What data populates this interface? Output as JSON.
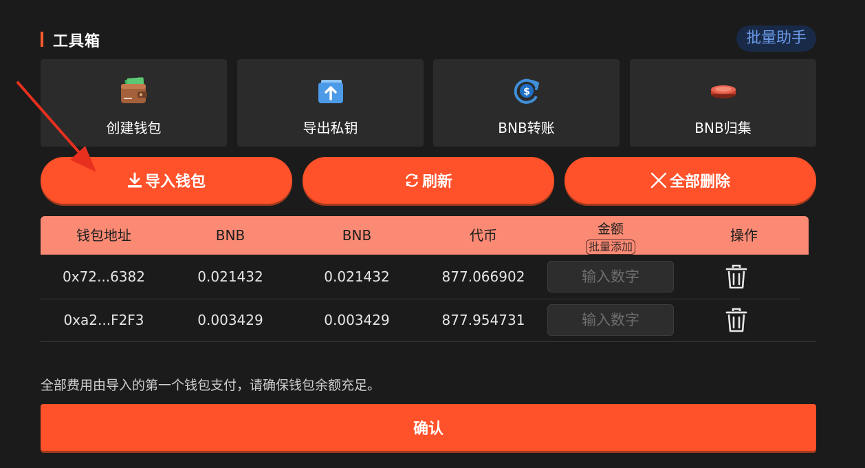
{
  "header": {
    "title": "工具箱",
    "batch_assist_label": "批量助手"
  },
  "tools": [
    {
      "label": "创建钱包",
      "icon": "wallet-icon"
    },
    {
      "label": "导出私钥",
      "icon": "export-key-icon"
    },
    {
      "label": "BNB转账",
      "icon": "transfer-coin-icon"
    },
    {
      "label": "BNB归集",
      "icon": "coin-stack-icon"
    }
  ],
  "actions": {
    "import_label": "导入钱包",
    "refresh_label": "刷新",
    "delete_all_label": "全部删除"
  },
  "table": {
    "headers": {
      "address": "钱包地址",
      "bnb1": "BNB",
      "bnb2": "BNB",
      "token": "代币",
      "amount": "金额",
      "batch_add": "批量添加",
      "operation": "操作"
    },
    "amount_placeholder": "输入数字",
    "rows": [
      {
        "address": "0x72...6382",
        "bnb1": "0.021432",
        "bnb2": "0.021432",
        "token": "877.066902"
      },
      {
        "address": "0xa2...F2F3",
        "bnb1": "0.003429",
        "bnb2": "0.003429",
        "token": "877.954731"
      }
    ]
  },
  "note": "全部费用由导入的第一个钱包支付，请确保钱包余额充足。",
  "confirm_label": "确认",
  "colors": {
    "accent": "#ff512a",
    "table_header": "#fb8a74",
    "background": "#1b1b1b",
    "card": "#2b2b2b",
    "annotation_arrow": "#e8301f"
  }
}
